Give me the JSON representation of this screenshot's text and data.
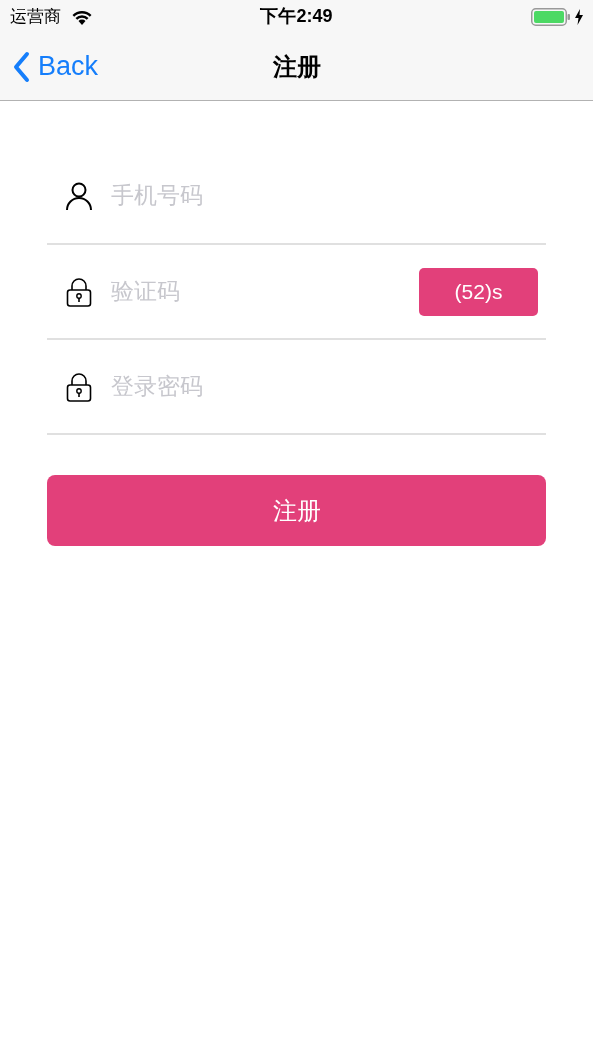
{
  "status_bar": {
    "carrier": "运营商",
    "time": "下午2:49"
  },
  "nav_bar": {
    "back": "Back",
    "title": "注册"
  },
  "fields": [
    {
      "kind": "user",
      "placeholder": "手机号码"
    },
    {
      "kind": "lock",
      "placeholder": "验证码",
      "action": "(52)s"
    },
    {
      "kind": "lock",
      "placeholder": "登录密码"
    }
  ],
  "submit_button": "注册"
}
